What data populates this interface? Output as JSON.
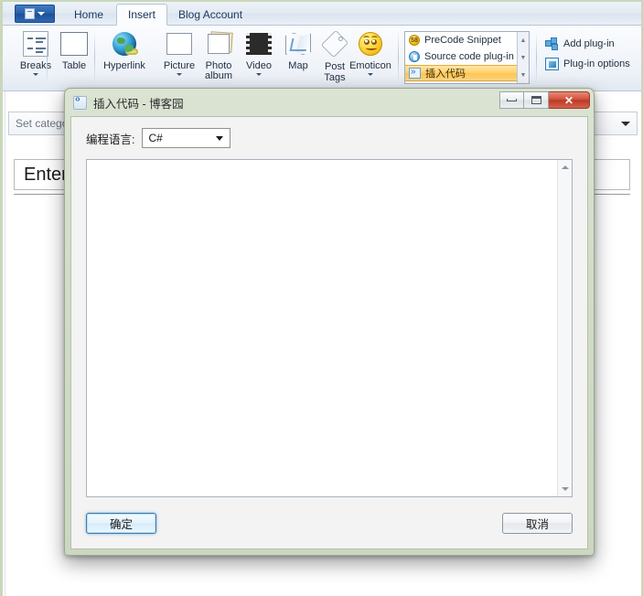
{
  "app": {
    "ribbon_tabs": [
      {
        "label": "Home",
        "active": false
      },
      {
        "label": "Insert",
        "active": true
      },
      {
        "label": "Blog Account",
        "active": false
      }
    ],
    "app_menu_icon": "application-menu-icon",
    "groups": {
      "insert_buttons": [
        {
          "label": "Breaks",
          "icon": "breaks-icon",
          "has_dropdown": true
        },
        {
          "label": "Table",
          "icon": "table-icon",
          "has_dropdown": false
        },
        {
          "label": "Hyperlink",
          "icon": "hyperlink-globe-icon",
          "has_dropdown": false
        },
        {
          "label": "Picture",
          "icon": "picture-icon",
          "has_dropdown": true
        },
        {
          "label": "Photo album",
          "icon": "photo-album-icon",
          "has_dropdown": true
        },
        {
          "label": "Video",
          "icon": "video-filmstrip-icon",
          "has_dropdown": true
        },
        {
          "label": "Map",
          "icon": "map-icon",
          "has_dropdown": false
        },
        {
          "label": "Post Tags",
          "icon": "tag-icon",
          "has_dropdown": false
        },
        {
          "label": "Emoticon",
          "icon": "emoticon-smiley-icon",
          "has_dropdown": true
        }
      ],
      "plugin_gallery": [
        {
          "label": "PreCode Snippet",
          "icon": "precode-snippet-icon",
          "badge": "58",
          "selected": false
        },
        {
          "label": "Source code plug-in",
          "icon": "source-code-plugin-icon",
          "selected": false
        },
        {
          "label": "插入代码",
          "icon": "insert-code-plugin-icon",
          "selected": true
        }
      ],
      "plugin_actions": [
        {
          "label": "Add plug-in",
          "icon": "puzzle-piece-icon"
        },
        {
          "label": "Plug-in options",
          "icon": "plugin-options-icon"
        }
      ]
    }
  },
  "editor": {
    "category_bar": {
      "text": "Set categories",
      "dropdown_icon": "chevron-down-icon"
    },
    "title_field": {
      "value": "",
      "placeholder": "Enter a post title"
    }
  },
  "dialog": {
    "title": "插入代码 - 博客园",
    "icon": "insert-code-dialog-icon",
    "window_buttons": {
      "minimize": "minimize-icon",
      "maximize": "maximize-icon",
      "close": "✕"
    },
    "language_label": "编程语言:",
    "language_value": "C#",
    "language_options": [
      "C#"
    ],
    "code_value": "",
    "scrollbar": {
      "up_icon": "scroll-up-arrow",
      "down_icon": "scroll-down-arrow"
    },
    "ok_button": "确定",
    "cancel_button": "取消"
  },
  "colors": {
    "ribbon_accent": "#d6e3f2",
    "selected_gallery_item": "#ffd271",
    "close_button": "#c4452f",
    "dialog_frame": "#cbd7bf",
    "focus_border": "#3c7fb1"
  }
}
